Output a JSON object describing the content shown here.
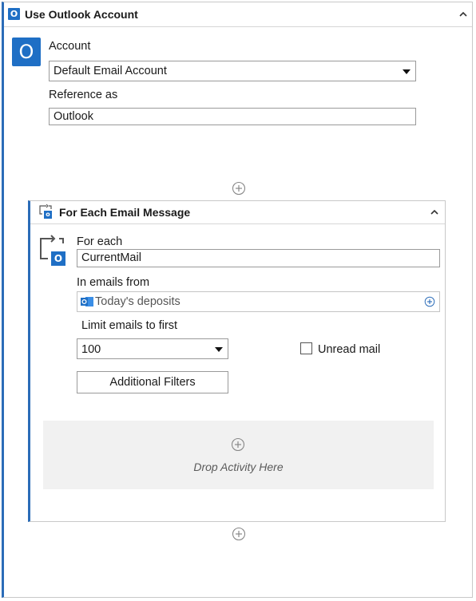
{
  "outer": {
    "title": "Use Outlook Account",
    "account_label": "Account",
    "account_value": "Default Email Account",
    "reference_label": "Reference as",
    "reference_value": "Outlook"
  },
  "inner": {
    "title": "For Each Email Message",
    "for_each_label": "For each",
    "for_each_value": "CurrentMail",
    "in_emails_label": "In emails from",
    "folder_value": "Today's deposits",
    "limit_label": "Limit emails to first",
    "limit_value": "100",
    "unread_label": "Unread mail",
    "unread_checked": false,
    "filters_button": "Additional Filters",
    "drop_text": "Drop Activity Here"
  },
  "icons": {
    "outlook_badge": "O",
    "outlook_large": "O",
    "inner_outlook_badge": "o",
    "activity_outlook": "O"
  },
  "colors": {
    "accent": "#2b6cb8",
    "outlook_blue": "#1f6fc5",
    "drop_zone": "#f1f1f1",
    "border": "#c8c8c8"
  }
}
